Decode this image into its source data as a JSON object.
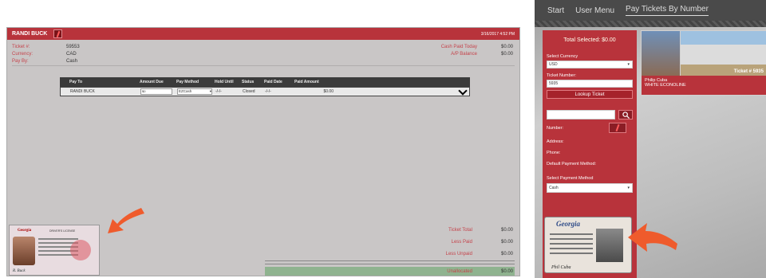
{
  "left": {
    "customer_name": "RANDI BUCK",
    "date": "3/16/2017 4:52 PM",
    "info": [
      {
        "label": "Ticket #:",
        "value": "59553"
      },
      {
        "label": "Currency:",
        "value": "CAD"
      },
      {
        "label": "Pay By:",
        "value": "Cash"
      }
    ],
    "right_info": [
      {
        "label": "Cash Paid Today",
        "value": "$0.00"
      },
      {
        "label": "A/P Balance",
        "value": "$0.00"
      }
    ],
    "table": {
      "headers": [
        "Pay To",
        "Amount Due",
        "Pay Method",
        "Hold Until",
        "Status",
        "Paid Date",
        "Paid Amount"
      ],
      "row": {
        "pay_to": "RANDI BUCK",
        "amount_due": "$0",
        "pay_method": "EZCash",
        "hold_until": "-/-/-",
        "status": "Closed",
        "paid_date": "-/-/-",
        "paid_amount": "$0.00"
      }
    },
    "totals": [
      {
        "label": "Ticket Total",
        "value": "$0.00"
      },
      {
        "label": "Less Paid",
        "value": "$0.00"
      },
      {
        "label": "Less Unpaid",
        "value": "$0.00"
      }
    ],
    "unallocated": {
      "label": "Unallocated",
      "value": "$0.00"
    },
    "license": {
      "title": "Georgia",
      "subtitle": "DRIVER'S LICENSE"
    }
  },
  "right": {
    "nav": [
      "Start",
      "User Menu",
      "Pay Tickets By Number"
    ],
    "total_selected": "Total Selected: $0.00",
    "currency_label": "Select Currency",
    "currency_value": "USD",
    "ticket_label": "Ticket Number:",
    "ticket_value": "5935",
    "lookup_button": "Lookup Ticket",
    "number_label": "Number:",
    "address_label": "Address:",
    "phone_label": "Phone:",
    "default_payment_label": "Default Payment Method:",
    "payment_label": "Select Payment Method",
    "payment_value": "Cash",
    "card": {
      "name": "Philip Cuba",
      "vehicle": "WHITE ECONOLINE",
      "ticket": "Ticket # 5935"
    },
    "license": {
      "title": "Georgia"
    }
  },
  "colors": {
    "accent": "#b8333b",
    "arrow": "#ef5b2c"
  },
  "icons": [
    "edit-icon",
    "search-icon",
    "chevron-down-icon",
    "arrow-icon"
  ]
}
